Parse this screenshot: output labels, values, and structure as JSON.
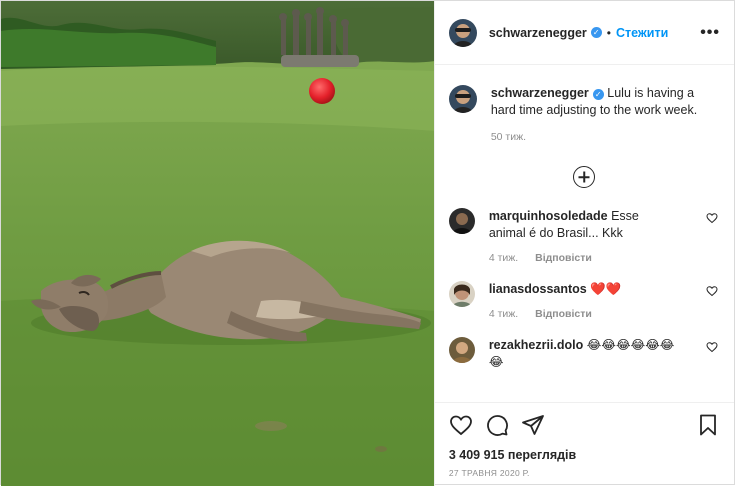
{
  "header": {
    "username": "schwarzenegger",
    "follow_label": "Стежити",
    "separator": "•",
    "more": "•••"
  },
  "caption": {
    "username": "schwarzenegger",
    "text": "Lulu is having a hard time adjusting to the work week.",
    "time": "50 тиж."
  },
  "comments": [
    {
      "username": "marquinhosoledade",
      "text": "Esse animal é do Brasil... Kkk",
      "time": "4 тиж.",
      "reply": "Відповісти"
    },
    {
      "username": "lianasdossantos",
      "text": "❤️❤️",
      "time": "4 тиж.",
      "reply": "Відповісти"
    },
    {
      "username": "rezakhezrii.dolo",
      "text": "😂😂😂😂😂😂😂",
      "time": "",
      "reply": ""
    }
  ],
  "footer": {
    "views": "3 409 915 переглядів",
    "date": "27 ТРАВНЯ 2020 Р."
  },
  "colors": {
    "link_blue": "#0095f6",
    "verified_blue": "#3897f0",
    "muted": "#8e8e8e",
    "heart_red": "#ed4956"
  },
  "icons": {
    "like": "heart-icon",
    "comment": "comment-icon",
    "share": "paper-plane-icon",
    "save": "bookmark-icon",
    "load_more": "plus-circle-icon"
  }
}
